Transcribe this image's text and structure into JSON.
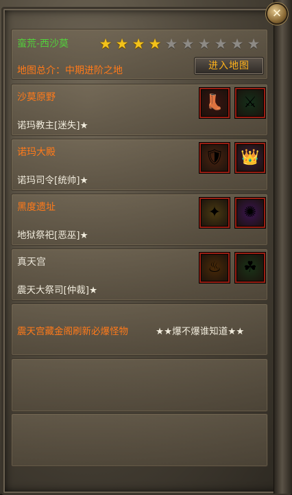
{
  "header": {
    "map_name": "蛮荒-西沙莫",
    "stars_filled": 4,
    "stars_total": 10,
    "summary": "地图总介：中期进阶之地",
    "enter_button": "进入地图"
  },
  "close_glyph": "✕",
  "bosses": [
    {
      "location": "沙莫原野",
      "boss": "诺玛教主[迷失]★",
      "title_color": "orange",
      "items": [
        {
          "icon": "boots-icon",
          "glyph": "👢",
          "bg": "#3a1410"
        },
        {
          "icon": "staff-icon",
          "glyph": "⚔",
          "bg": "#14301a"
        }
      ]
    },
    {
      "location": "诺玛大殿",
      "boss": "诺玛司令[统帅]★",
      "title_color": "orange",
      "items": [
        {
          "icon": "armor-icon",
          "glyph": "🛡",
          "bg": "#4a2310"
        },
        {
          "icon": "helmet-icon",
          "glyph": "👑",
          "bg": "#3b1d3a"
        }
      ]
    },
    {
      "location": "黑度遗址",
      "boss": "地狱祭祀[恶巫]★",
      "title_color": "orange",
      "items": [
        {
          "icon": "wings-icon",
          "glyph": "✦",
          "bg": "#4a3a12"
        },
        {
          "icon": "orb-icon",
          "glyph": "✺",
          "bg": "#3a1450"
        }
      ]
    },
    {
      "location": "真天宫",
      "boss": "震天大祭司[仲裁]★",
      "title_color": "white",
      "items": [
        {
          "icon": "flame-icon",
          "glyph": "♨",
          "bg": "#4a2a08"
        },
        {
          "icon": "goblin-icon",
          "glyph": "☘",
          "bg": "#1a3318"
        }
      ]
    }
  ],
  "notice": {
    "text": "震天宫藏金阁刷新必爆怪物",
    "tag": "★★爆不爆谁知道★★"
  }
}
